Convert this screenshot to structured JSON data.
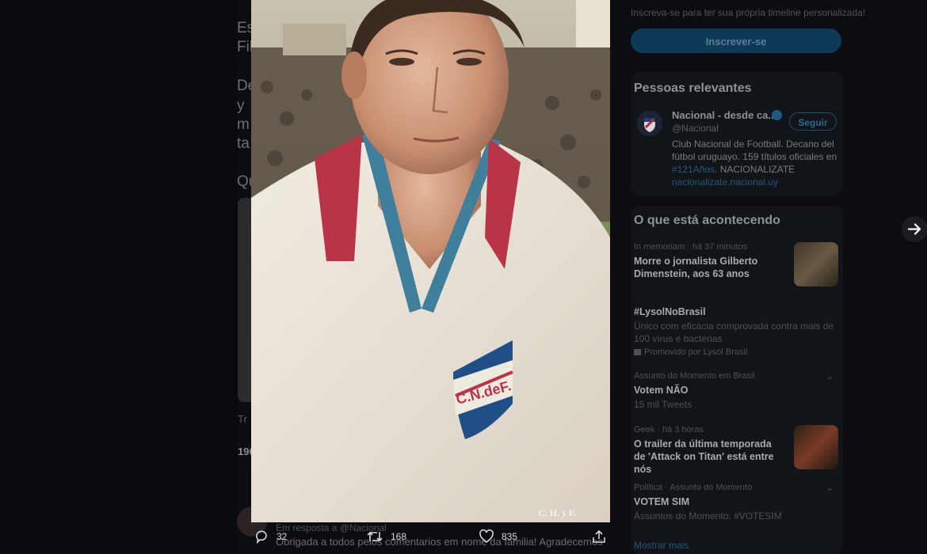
{
  "background": {
    "text_lines": [
      "Es",
      "Fil",
      "De",
      "y",
      "m",
      "ta",
      "Qu"
    ],
    "small_a": "Tr",
    "small_b": "196"
  },
  "sidebar": {
    "signup_text": "Inscreva-se para ter sua própria timeline personalizada!",
    "signup_button": "Inscrever-se",
    "relevant_title": "Pessoas relevantes",
    "person": {
      "name": "Nacional - desde ca...",
      "handle": "@Nacional",
      "follow_label": "Seguir",
      "bio_part1": "Club Nacional de Football. Decano del fútbol uruguayo. 159 títulos oficiales en ",
      "bio_hashtag": "#121Años",
      "bio_part2": ". NACIONALIZATE",
      "link": "nacionalizate.nacional.uy"
    },
    "trends_title": "O que está acontecendo",
    "trends": [
      {
        "meta": "In memoriam · há 37 minutos",
        "title": "Morre o jornalista Gilberto Dimenstein, aos 63 anos"
      },
      {
        "meta": "",
        "title": "#LysolNoBrasil",
        "sub": "Único com eficácia comprovada contra mais de 100 vírus e bactérias",
        "promo": "Promovido por Lysol Brasil"
      },
      {
        "meta": "Assunto do Momento em Brasil",
        "title": "Votem NÃO",
        "sub": "15 mil Tweets"
      },
      {
        "meta": "Geek · há 3 horas",
        "title": "O trailer da última temporada de 'Attack on Titan' está entre nós"
      },
      {
        "meta": "Política · Assunto do Momento",
        "title": "VOTEM SIM",
        "sub": "Assuntos do Momento: #VOTESIM"
      }
    ],
    "show_more": "Mostrar mais"
  },
  "photo": {
    "crest_text": "C.N.deF.",
    "watermark": "C. H. y F."
  },
  "reply_preview": {
    "replying_to": "Em resposta a @Nacional",
    "text": "Obrigada a todos pelos comentarios em nome da familia! Agradecemos"
  },
  "actions": {
    "replies": "32",
    "retweets": "168",
    "likes": "835"
  }
}
